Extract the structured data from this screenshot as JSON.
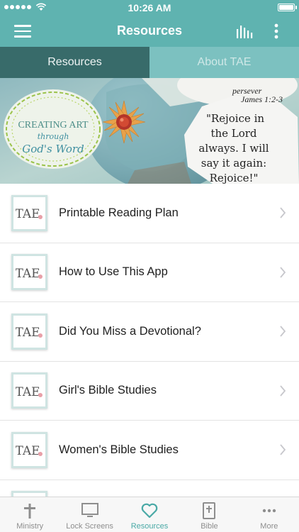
{
  "status_bar": {
    "time": "10:26 AM"
  },
  "nav": {
    "title": "Resources",
    "menu_icon": "hamburger-icon",
    "stats_icon": "bar-chart-icon",
    "more_icon": "vertical-dots-icon"
  },
  "tabs": [
    {
      "label": "Resources",
      "active": true
    },
    {
      "label": "About TAE",
      "active": false
    }
  ],
  "banner": {
    "logo_line1": "CREATING ART",
    "logo_line2": "through",
    "logo_line3": "God's Word",
    "card_text": [
      "\"Rejoice in",
      "the Lord",
      "always. I will",
      "say it again:",
      "Rejoice!\""
    ],
    "top_text": [
      "persever",
      "James 1:2-3"
    ]
  },
  "list": {
    "thumb_text": "TAE",
    "items": [
      {
        "label": "Printable Reading Plan"
      },
      {
        "label": "How to Use This App"
      },
      {
        "label": "Did You Miss a Devotional?"
      },
      {
        "label": "Girl's Bible Studies"
      },
      {
        "label": "Women's Bible Studies"
      }
    ]
  },
  "tab_bar": [
    {
      "label": "Ministry",
      "icon": "cross-icon",
      "active": false
    },
    {
      "label": "Lock Screens",
      "icon": "monitor-icon",
      "active": false
    },
    {
      "label": "Resources",
      "icon": "heart-icon",
      "active": true
    },
    {
      "label": "Bible",
      "icon": "bible-icon",
      "active": false
    },
    {
      "label": "More",
      "icon": "ellipsis-icon",
      "active": false
    }
  ],
  "colors": {
    "accent": "#5fb3b0",
    "tab_active": "#386b6a",
    "tab_inactive": "#7cc1c0",
    "tab_bar_active": "#4aa9a6"
  }
}
